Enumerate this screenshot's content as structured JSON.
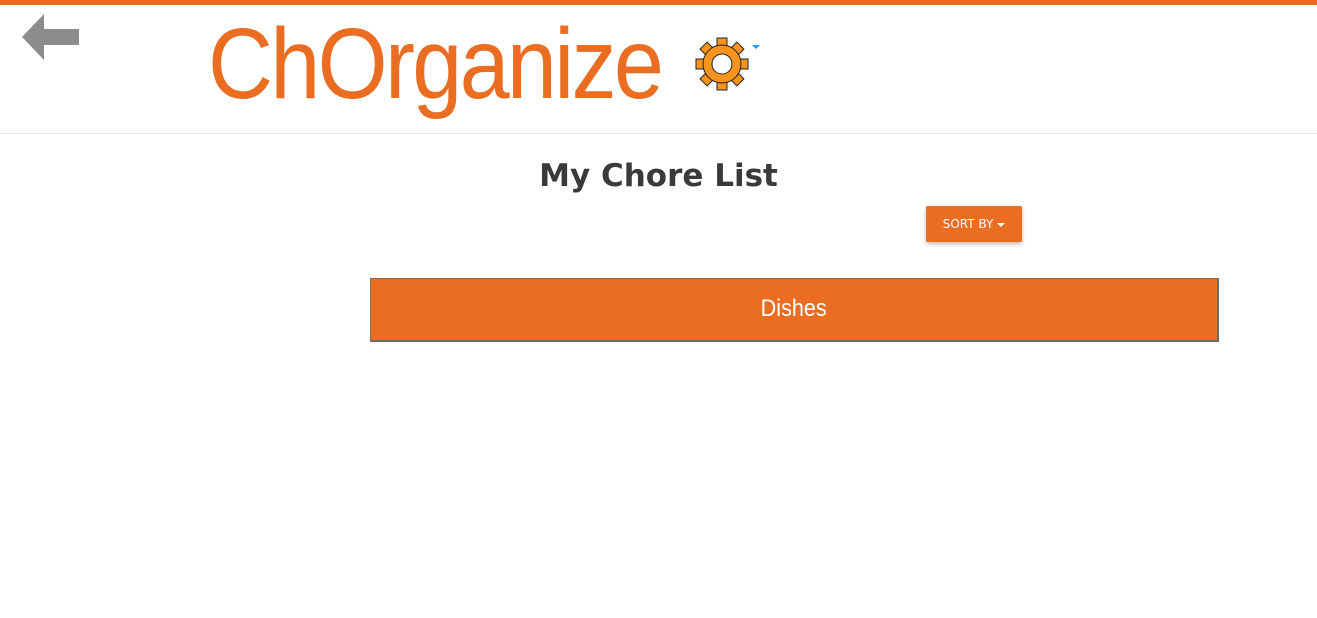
{
  "header": {
    "app_title": "ChOrganize",
    "back_icon": "back-arrow-icon",
    "settings_icon": "gear-icon",
    "settings_caret_icon": "caret-down-icon"
  },
  "main": {
    "page_title": "My Chore List",
    "sort_button_label": "SORT BY",
    "chores": [
      {
        "name": "Dishes"
      }
    ]
  },
  "colors": {
    "brand": "#ea6d22",
    "back_arrow": "#8c8c8c",
    "caret_accent": "#2196f3",
    "title_text": "#3a3a3a"
  }
}
